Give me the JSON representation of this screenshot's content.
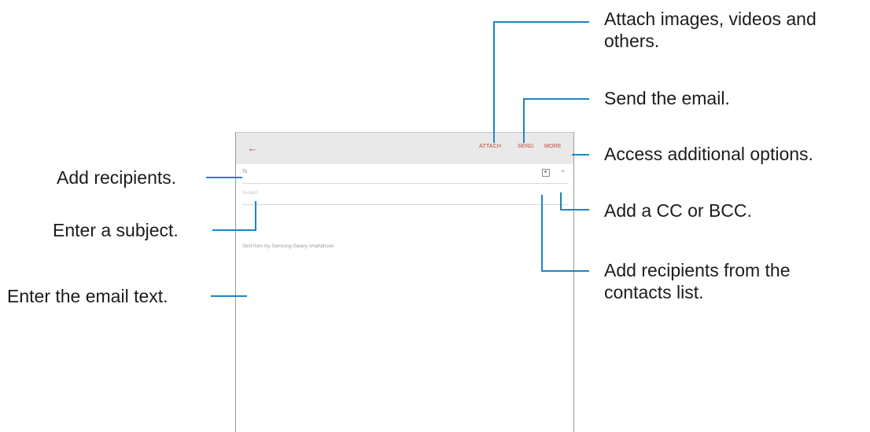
{
  "screen": {
    "back_icon": "arrow-left-icon",
    "actions": {
      "attach": "ATTACH",
      "send": "SEND",
      "more": "MORE"
    },
    "to_label": "To",
    "contacts_icon": "contact-card-icon",
    "expand_icon": "chevron-down-icon",
    "subject_placeholder": "Subject",
    "signature": "Sent from my Samsung Galaxy smartphone"
  },
  "callouts": {
    "attach": [
      "Attach images, videos and",
      "others."
    ],
    "send": "Send the email.",
    "more": "Access additional options.",
    "add_recipients": "Add recipients.",
    "cc_bcc": "Add a CC or BCC.",
    "subject": "Enter a subject.",
    "contacts": [
      "Add recipients from the",
      "contacts list."
    ],
    "email_text": "Enter the email text."
  },
  "colors": {
    "accent": "#c2453c",
    "callout_line": "#1d84c6",
    "appbar": "#e9e9e9"
  }
}
